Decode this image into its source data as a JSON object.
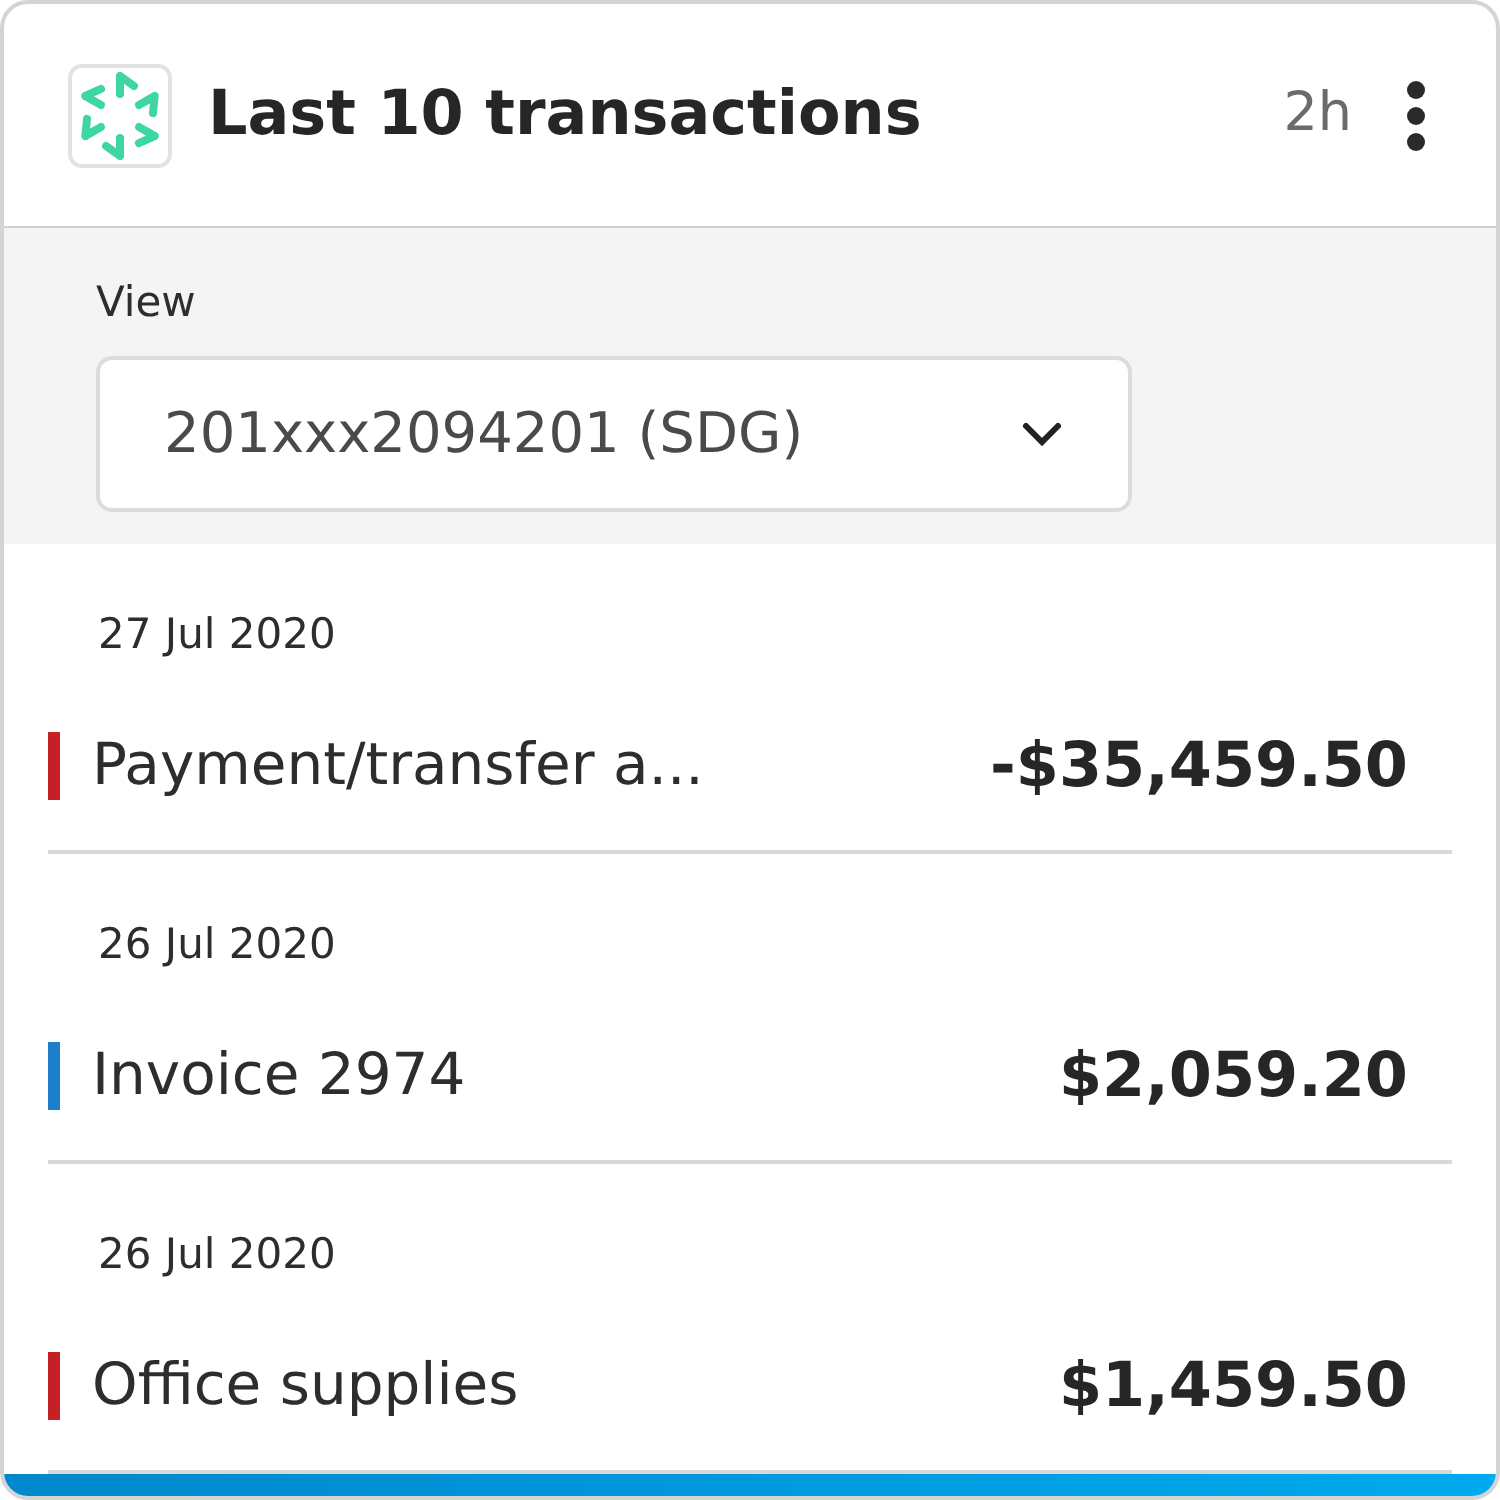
{
  "header": {
    "title": "Last 10 transactions",
    "age": "2h"
  },
  "view": {
    "label": "View",
    "value": "201xxx2094201 (SDG)"
  },
  "transactions": [
    {
      "date": "27 Jul 2020",
      "description": "Payment/transfer a...",
      "amount": "-$35,459.50",
      "color": "#c42026"
    },
    {
      "date": "26 Jul 2020",
      "description": "Invoice 2974",
      "amount": "$2,059.20",
      "color": "#1b7fcc"
    },
    {
      "date": "26 Jul 2020",
      "description": "Office supplies",
      "amount": "$1,459.50",
      "color": "#c42026"
    }
  ]
}
